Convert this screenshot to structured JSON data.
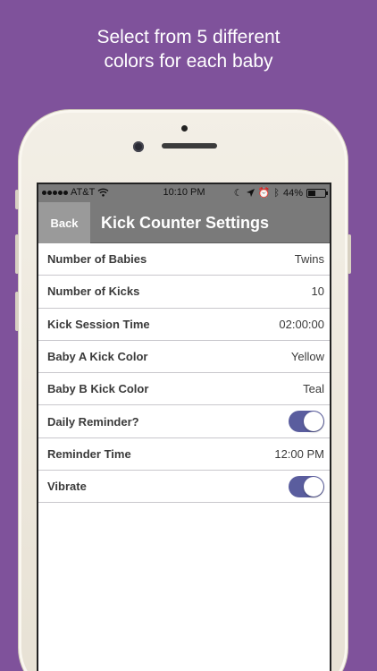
{
  "headline": [
    "Select from 5 different",
    "colors for each baby"
  ],
  "status_bar": {
    "carrier": "AT&T",
    "time": "10:10 PM",
    "battery": "44%",
    "icons": [
      "signal-dots-icon",
      "wifi-icon",
      "moon-icon",
      "location-arrow-icon",
      "alarm-icon",
      "bluetooth-icon",
      "battery-icon"
    ]
  },
  "nav": {
    "back_label": "Back",
    "title": "Kick Counter Settings"
  },
  "settings": [
    {
      "label": "Number of Babies",
      "value": "Twins"
    },
    {
      "label": "Number of Kicks",
      "value": "10"
    },
    {
      "label": "Kick Session Time",
      "value": "02:00:00"
    },
    {
      "label": "Baby A Kick Color",
      "value": "Yellow"
    },
    {
      "label": "Baby B Kick Color",
      "value": "Teal"
    },
    {
      "label": "Daily Reminder?",
      "toggle": true
    },
    {
      "label": "Reminder Time",
      "value": "12:00 PM"
    },
    {
      "label": "Vibrate",
      "toggle": true
    }
  ],
  "colors": {
    "background": "#7f529b",
    "navbar": "#7a7a7a",
    "toggle_on": "#5a5d9e"
  }
}
